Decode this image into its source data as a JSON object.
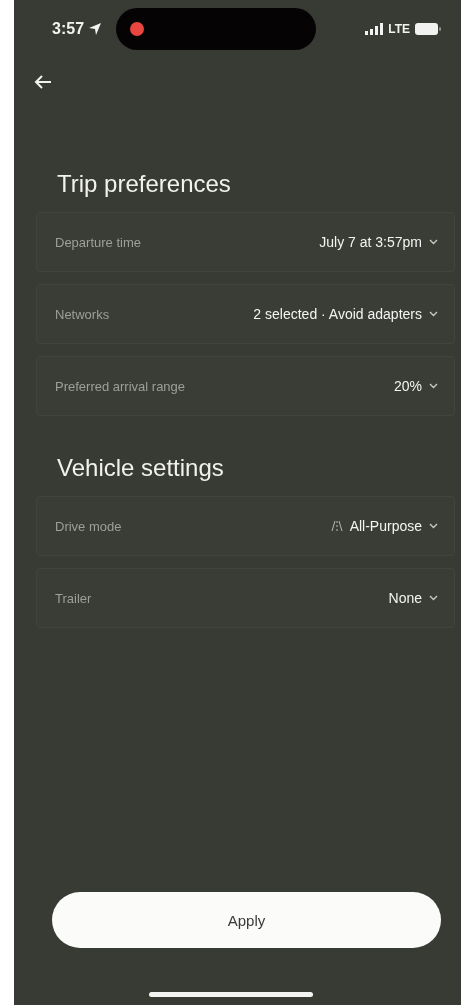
{
  "status_bar": {
    "time": "3:57",
    "network": "LTE"
  },
  "sections": [
    {
      "title": "Trip preferences",
      "rows": [
        {
          "kind": "plain",
          "label": "Departure time",
          "value": "July 7 at 3:57pm"
        },
        {
          "kind": "plain",
          "label": "Networks",
          "value": "2 selected · Avoid adapters"
        },
        {
          "kind": "plain",
          "label": "Preferred arrival range",
          "value": "20%"
        }
      ]
    },
    {
      "title": "Vehicle settings",
      "rows": [
        {
          "kind": "with-icon",
          "label": "Drive mode",
          "value": "All-Purpose"
        },
        {
          "kind": "plain",
          "label": "Trailer",
          "value": "None"
        }
      ]
    }
  ],
  "apply_button": {
    "label": "Apply"
  }
}
